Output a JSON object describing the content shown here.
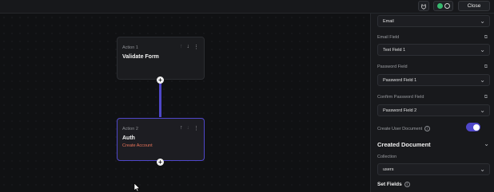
{
  "topbar": {
    "close_label": "Close",
    "icons": [
      "plug-icon",
      "status-icon",
      "globe-icon"
    ]
  },
  "canvas": {
    "actions": [
      {
        "number_label": "Action 1",
        "title": "Validate Form",
        "subtitle": ""
      },
      {
        "number_label": "Action 2",
        "title": "Auth",
        "subtitle": "Create Account"
      }
    ]
  },
  "panel": {
    "top_dropdown": "Email",
    "fields": [
      {
        "label": "Email Field",
        "value": "Text Field 1"
      },
      {
        "label": "Password Field",
        "value": "Password Field 1"
      },
      {
        "label": "Confirm Password Field",
        "value": "Password Field 2"
      }
    ],
    "create_user_document_label": "Create User Document",
    "create_user_document_enabled": true,
    "created_document_title": "Created Document",
    "collection_label": "Collection",
    "collection_value": "users",
    "set_fields_label": "Set Fields"
  },
  "colors": {
    "accent": "#4f47c9",
    "subtitle": "#e8735a"
  }
}
